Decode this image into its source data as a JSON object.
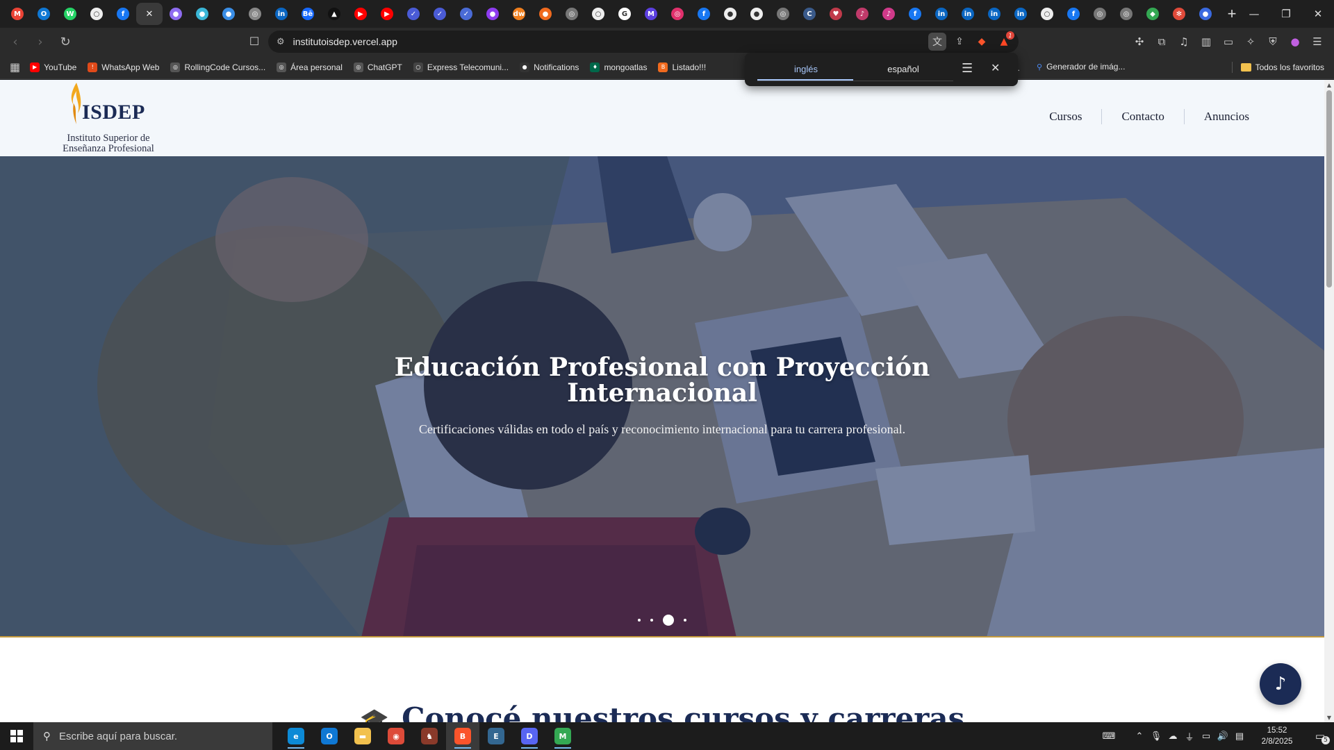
{
  "browser": {
    "tabs": [
      {
        "icon": "gmail-icon",
        "color": "#ea4335",
        "glyph": "M"
      },
      {
        "icon": "outlook-icon",
        "color": "#0f78d4",
        "glyph": "O"
      },
      {
        "icon": "whatsapp-icon",
        "color": "#25d366",
        "glyph": "W"
      },
      {
        "icon": "chrome-icon",
        "color": "#eeeeee",
        "glyph": "○"
      },
      {
        "icon": "facebook-icon",
        "color": "#1877f2",
        "glyph": "f"
      },
      {
        "icon": "close-icon",
        "color": "#3a3a3a",
        "glyph": "✕",
        "active": true
      },
      {
        "icon": "app-icon",
        "color": "#8e6cf0",
        "glyph": "●"
      },
      {
        "icon": "app-icon",
        "color": "#3ab6d6",
        "glyph": "●"
      },
      {
        "icon": "app-icon",
        "color": "#3a8ee6",
        "glyph": "●"
      },
      {
        "icon": "app-icon",
        "color": "#888888",
        "glyph": "◎"
      },
      {
        "icon": "linkedin-icon",
        "color": "#0a66c2",
        "glyph": "in"
      },
      {
        "icon": "behance-icon",
        "color": "#1769ff",
        "glyph": "Bē"
      },
      {
        "icon": "app-icon",
        "color": "#111111",
        "glyph": "▲"
      },
      {
        "icon": "youtube-icon",
        "color": "#ff0000",
        "glyph": "▶"
      },
      {
        "icon": "youtube-icon",
        "color": "#ff0000",
        "glyph": "▶"
      },
      {
        "icon": "app-icon",
        "color": "#4a5bd6",
        "glyph": "✓"
      },
      {
        "icon": "app-icon",
        "color": "#4a5bd6",
        "glyph": "✓"
      },
      {
        "icon": "app-icon",
        "color": "#4a6bd6",
        "glyph": "✓"
      },
      {
        "icon": "app-icon",
        "color": "#8e3cf0",
        "glyph": "●"
      },
      {
        "icon": "app-icon",
        "color": "#f07f1e",
        "glyph": "dw"
      },
      {
        "icon": "app-icon",
        "color": "#f06a1e",
        "glyph": "●"
      },
      {
        "icon": "app-icon",
        "color": "#777777",
        "glyph": "◎"
      },
      {
        "icon": "app-icon",
        "color": "#eeeeee",
        "glyph": "○"
      },
      {
        "icon": "google-icon",
        "color": "#ffffff",
        "glyph": "G"
      },
      {
        "icon": "app-icon",
        "color": "#5b3fe0",
        "glyph": "M"
      },
      {
        "icon": "instagram-icon",
        "color": "#e1306c",
        "glyph": "◎"
      },
      {
        "icon": "facebook-icon",
        "color": "#1877f2",
        "glyph": "f"
      },
      {
        "icon": "github-icon",
        "color": "#eeeeee",
        "glyph": "●"
      },
      {
        "icon": "github-icon",
        "color": "#eeeeee",
        "glyph": "●"
      },
      {
        "icon": "app-icon",
        "color": "#777777",
        "glyph": "◎"
      },
      {
        "icon": "app-icon",
        "color": "#3a5a8a",
        "glyph": "C"
      },
      {
        "icon": "app-icon",
        "color": "#c03a4a",
        "glyph": "♥"
      },
      {
        "icon": "app-icon",
        "color": "#c03a6a",
        "glyph": "♪"
      },
      {
        "icon": "app-icon",
        "color": "#d03a8a",
        "glyph": "♪"
      },
      {
        "icon": "facebook-icon",
        "color": "#1877f2",
        "glyph": "f"
      },
      {
        "icon": "linkedin-icon",
        "color": "#0a66c2",
        "glyph": "in"
      },
      {
        "icon": "linkedin-icon",
        "color": "#0a66c2",
        "glyph": "in"
      },
      {
        "icon": "linkedin-icon",
        "color": "#0a66c2",
        "glyph": "in"
      },
      {
        "icon": "linkedin-icon",
        "color": "#0a66c2",
        "glyph": "in"
      },
      {
        "icon": "app-icon",
        "color": "#eeeeee",
        "glyph": "○"
      },
      {
        "icon": "facebook-icon",
        "color": "#1877f2",
        "glyph": "f"
      },
      {
        "icon": "app-icon",
        "color": "#777777",
        "glyph": "◎"
      },
      {
        "icon": "app-icon",
        "color": "#777777",
        "glyph": "◎"
      },
      {
        "icon": "maps-icon",
        "color": "#34a853",
        "glyph": "◆"
      },
      {
        "icon": "app-icon",
        "color": "#e04a3a",
        "glyph": "✻"
      },
      {
        "icon": "app-icon",
        "color": "#3a6ae0",
        "glyph": "●"
      }
    ],
    "new_tab": "+",
    "url": "institutoisdep.vercel.app",
    "bookmarks": [
      {
        "label": "YouTube",
        "color": "#ff0000",
        "glyph": "▶"
      },
      {
        "label": "WhatsApp Web",
        "color": "#e04a1a",
        "glyph": "!"
      },
      {
        "label": "RollingCode Cursos...",
        "color": "#555555",
        "glyph": "◎"
      },
      {
        "label": "Área personal",
        "color": "#555555",
        "glyph": "◎"
      },
      {
        "label": "ChatGPT",
        "color": "#555555",
        "glyph": "◎"
      },
      {
        "label": "Express Telecomuni...",
        "color": "#444444",
        "glyph": "○"
      },
      {
        "label": "Notifications",
        "color": "#333333",
        "glyph": "●"
      },
      {
        "label": "mongoatlas",
        "color": "#00684a",
        "glyph": "♦"
      },
      {
        "label": "Listado!!!",
        "color": "#f06a1e",
        "glyph": "B"
      }
    ],
    "bookmark_partial": "...",
    "bookmark_generator": "Generador de imág...",
    "all_bookmarks": "Todos los favoritos",
    "translate": {
      "lang_1": "inglés",
      "lang_2": "español"
    }
  },
  "site": {
    "logo_brand": "ISDEP",
    "logo_tagline_1": "Instituto Superior de",
    "logo_tagline_2": "Enseñanza Profesional",
    "nav": [
      "Cursos",
      "Contacto",
      "Anuncios"
    ],
    "hero": {
      "title_line_1": "Educación Profesional con Proyección",
      "title_line_2": "Internacional",
      "subtitle": "Certificaciones válidas en todo el país y reconocimiento internacional para tu carrera profesional.",
      "slides": 4,
      "active_slide": 3
    },
    "section_title": "Conocé nuestros cursos y carreras",
    "colors": {
      "navy": "#1b2b55",
      "gold": "#c69b3d"
    }
  },
  "taskbar": {
    "search_placeholder": "Escribe aquí para buscar.",
    "apps": [
      {
        "icon": "edge-icon",
        "color": "#0c8ad6",
        "glyph": "e",
        "running": true
      },
      {
        "icon": "outlook-icon",
        "color": "#0f78d4",
        "glyph": "O",
        "running": false
      },
      {
        "icon": "file-explorer-icon",
        "color": "#f2c14e",
        "glyph": "▬",
        "running": false
      },
      {
        "icon": "chrome-icon",
        "color": "#dd4b39",
        "glyph": "◉",
        "running": false
      },
      {
        "icon": "game-icon",
        "color": "#8a3a2a",
        "glyph": "♞",
        "running": false
      },
      {
        "icon": "brave-icon",
        "color": "#fb542b",
        "glyph": "B",
        "running": true,
        "active": true
      },
      {
        "icon": "pgadmin-icon",
        "color": "#336791",
        "glyph": "E",
        "running": false
      },
      {
        "icon": "discord-icon",
        "color": "#5865f2",
        "glyph": "D",
        "running": true
      },
      {
        "icon": "chrome-gmail-icon",
        "color": "#34a853",
        "glyph": "M",
        "running": true
      }
    ],
    "time": "15:52",
    "date": "2/8/2025",
    "notifications": "5"
  }
}
